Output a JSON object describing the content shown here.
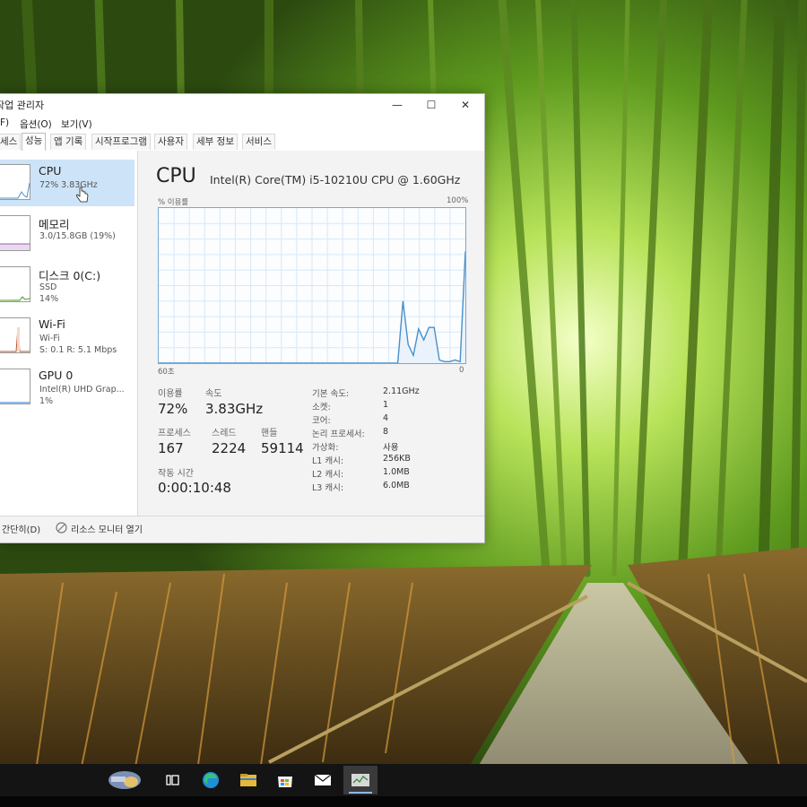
{
  "window": {
    "title": "작업 관리자",
    "controls": {
      "minimize": "—",
      "maximize": "☐",
      "close": "✕"
    }
  },
  "menu": [
    "F)",
    "옵션(O)",
    "보기(V)"
  ],
  "tabs": [
    {
      "label": "세스"
    },
    {
      "label": "성능",
      "active": true
    },
    {
      "label": "앱 기록"
    },
    {
      "label": "시작프로그램"
    },
    {
      "label": "사용자"
    },
    {
      "label": "세부 정보"
    },
    {
      "label": "서비스"
    }
  ],
  "sidebar": [
    {
      "name": "CPU",
      "line1": "72% 3.83GHz",
      "selected": true
    },
    {
      "name": "메모리",
      "line1": "3.0/15.8GB (19%)"
    },
    {
      "name": "디스크 0(C:)",
      "line1": "SSD",
      "line2": "14%"
    },
    {
      "name": "Wi-Fi",
      "line1": "Wi-Fi",
      "line2": "S: 0.1  R: 5.1 Mbps"
    },
    {
      "name": "GPU 0",
      "line1": "Intel(R) UHD Grap...",
      "line2": "1%"
    }
  ],
  "cpu": {
    "heading": "CPU",
    "model": "Intel(R) Core(TM) i5-10210U CPU @ 1.60GHz",
    "graph_label": "% 이용률",
    "graph_max": "100%",
    "graph_time": "60초",
    "graph_min": "0",
    "utilization_history": [
      0,
      0,
      0,
      0,
      0,
      0,
      0,
      0,
      0,
      0,
      0,
      0,
      0,
      0,
      0,
      0,
      0,
      0,
      0,
      0,
      0,
      0,
      0,
      0,
      0,
      0,
      0,
      0,
      0,
      0,
      0,
      0,
      0,
      0,
      0,
      0,
      0,
      0,
      0,
      0,
      0,
      0,
      0,
      0,
      0,
      0,
      0,
      40,
      12,
      5,
      22,
      15,
      23,
      23,
      2,
      1,
      1,
      2,
      1,
      72
    ],
    "stats": {
      "utilization_label": "이용률",
      "utilization": "72%",
      "speed_label": "속도",
      "speed": "3.83GHz",
      "processes_label": "프로세스",
      "processes": "167",
      "threads_label": "스레드",
      "threads": "2224",
      "handles_label": "핸들",
      "handles": "59114",
      "uptime_label": "작동 시간",
      "uptime": "0:00:10:48"
    },
    "details": [
      {
        "label": "기본 속도:",
        "value": "2.11GHz"
      },
      {
        "label": "소켓:",
        "value": "1"
      },
      {
        "label": "코어:",
        "value": "4"
      },
      {
        "label": "논리 프로세서:",
        "value": "8"
      },
      {
        "label": "가상화:",
        "value": "사용"
      },
      {
        "label": "L1 캐시:",
        "value": "256KB"
      },
      {
        "label": "L2 캐시:",
        "value": "1.0MB"
      },
      {
        "label": "L3 캐시:",
        "value": "6.0MB"
      }
    ]
  },
  "footer": {
    "fewer_details": "간단히(D)",
    "resource_monitor": "리소스 모니터 열기"
  },
  "taskbar": [
    {
      "icon": "cortana-search-icon"
    },
    {
      "icon": "task-view-icon"
    },
    {
      "icon": "edge-icon"
    },
    {
      "icon": "file-explorer-icon"
    },
    {
      "icon": "microsoft-store-icon"
    },
    {
      "icon": "mail-icon"
    },
    {
      "icon": "task-manager-icon",
      "active": true
    }
  ],
  "colors": {
    "cpu_graph": "#4a90c8",
    "selection": "#cde3f7",
    "graph_border": "#7aa7cf"
  }
}
